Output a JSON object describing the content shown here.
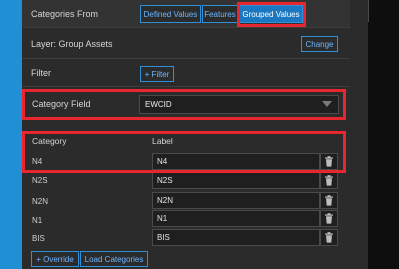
{
  "categories_from": {
    "label": "Categories From",
    "options": [
      "Defined Values",
      "Features",
      "Grouped Values"
    ],
    "selected": "Grouped Values"
  },
  "layer": {
    "label": "Layer: Group Assets",
    "change_label": "Change"
  },
  "filter": {
    "label": "Filter",
    "button_label": "+ Filter"
  },
  "category_field": {
    "label": "Category Field",
    "value": "EWCID"
  },
  "table": {
    "category_header": "Category",
    "label_header": "Label",
    "rows": [
      {
        "category": "N4",
        "label": "N4"
      },
      {
        "category": "N2S",
        "label": "N2S"
      },
      {
        "category": "N2N",
        "label": "N2N"
      },
      {
        "category": "N1",
        "label": "N1"
      },
      {
        "category": "BIS",
        "label": "BIS"
      }
    ]
  },
  "footer": {
    "override_label": "+ Override",
    "load_categories_label": "Load Categories"
  },
  "colors": {
    "accent": "#2f8fd8",
    "highlight": "#e8262e",
    "panel": "#2b2b2b",
    "left_strip": "#1f8fd6"
  },
  "icons": {
    "delete": "trash-icon",
    "dropdown": "chevron-down-icon"
  }
}
